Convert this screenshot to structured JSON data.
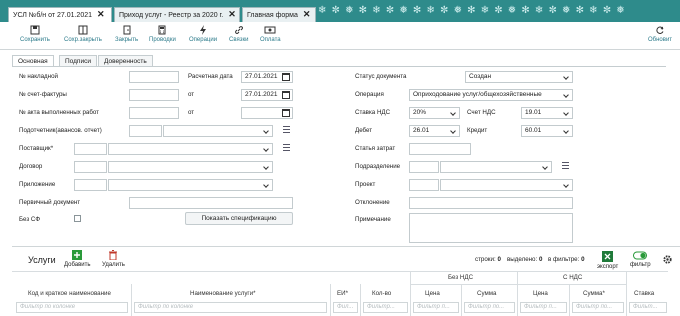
{
  "window_tabs": [
    {
      "label": "УСЛ №б/н от 27.01.2021",
      "close": "✕"
    },
    {
      "label": "Приход услуг - Реестр за 2020 г.",
      "close": "✕"
    },
    {
      "label": "Главная форма",
      "close": "✕"
    }
  ],
  "toolbar": {
    "save": "Сохранить",
    "save_close": "Сохр.закрыть",
    "close": "Закрыть",
    "postings": "Проводки",
    "operations": "Операции",
    "links": "Связки",
    "payment": "Оплата",
    "refresh": "Обновит"
  },
  "form_tabs": [
    "Основная",
    "Подписи",
    "Доверенность"
  ],
  "fields": {
    "invoice_no": "№ накладной",
    "settle_date": "Расчетная дата",
    "settle_date_val": "27.01.2021",
    "vat_invoice_no": "№ счет-фактуры",
    "from1": "от",
    "from1_val": "27.01.2021",
    "act_no": "№ акта выполненных работ",
    "from2": "от",
    "contractor": "Подотчетник(авансов. отчет)",
    "supplier": "Поставщик*",
    "contract": "Договор",
    "appendix": "Приложение",
    "primary_doc": "Первичный документ",
    "no_sf": "Без СФ",
    "show_spec": "Показать спецификацию",
    "doc_status": "Статус документа",
    "doc_status_val": "Создан",
    "operation": "Операция",
    "operation_val": "Оприходование услуг/общехозяйственные",
    "vat_rate": "Ставка НДС",
    "vat_rate_val": "20%",
    "vat_account": "Счет НДС",
    "vat_account_val": "19.01",
    "debit": "Дебет",
    "debit_val": "26.01",
    "credit": "Кредит",
    "credit_val": "60.01",
    "cost_item": "Статья затрат",
    "division": "Подразделение",
    "project": "Проект",
    "deviation": "Отклонение",
    "note": "Примечание"
  },
  "services": {
    "title": "Услуги",
    "add": "Добавить",
    "delete": "Удалить",
    "rows_label": "строки:",
    "rows_val": "0",
    "selected_label": "выделено:",
    "selected_val": "0",
    "in_filter_label": "в фильтре:",
    "in_filter_val": "0",
    "export": "экспорт",
    "filter": "фильтр",
    "group_no_vat": "Без НДС",
    "group_vat": "С НДС",
    "columns": [
      "Код и краткое наименование",
      "Наименование услуги*",
      "ЕИ*",
      "Кол-во",
      "Цена",
      "Сумма",
      "Цена",
      "Сумма*",
      "Ставка"
    ],
    "filters": [
      "Фильтр по колонке",
      "Фильтр по колонке",
      "Фил...",
      "Фильтр...",
      "Фильтр п...",
      "Фильтр по...",
      "Фильтр п...",
      "Фильтр по...",
      "Фильт..."
    ]
  },
  "colors": {
    "header": "#2e8b8b",
    "accent": "#2b7a8a",
    "excel": "#1f7a3a",
    "add": "#2a9a3a",
    "delete": "#c0392b"
  }
}
